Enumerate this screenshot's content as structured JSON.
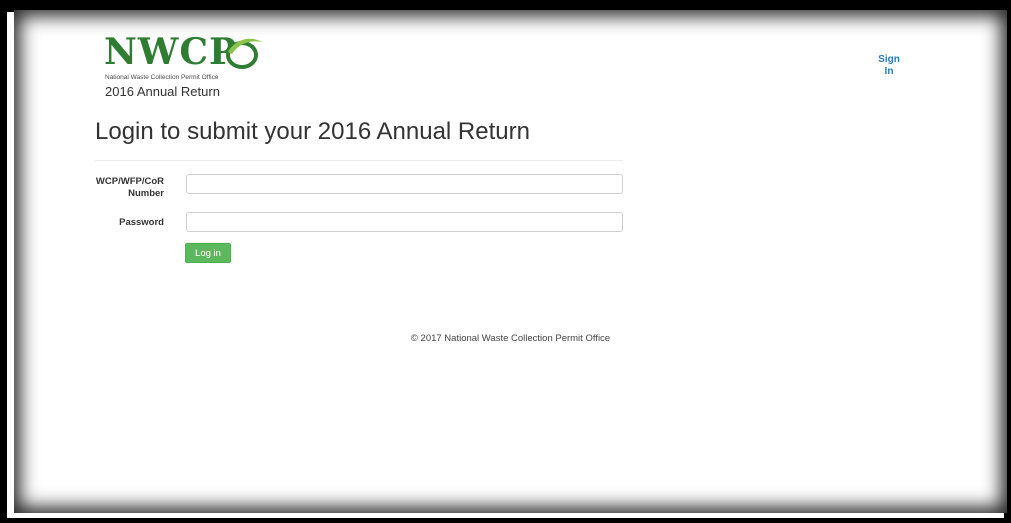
{
  "header": {
    "logo_text": "NWCPO",
    "logo_tagline": "National Waste Collection Permit Office",
    "subtitle": "2016 Annual Return",
    "sign_in_line1": "Sign",
    "sign_in_line2": "In"
  },
  "main": {
    "heading": "Login to submit your 2016 Annual Return",
    "form": {
      "wcp_label_line1": "WCP/WFP/CoR",
      "wcp_label_line2": "Number",
      "wcp_value": "",
      "password_label": "Password",
      "password_value": "",
      "login_button": "Log in"
    }
  },
  "footer": {
    "copyright": "© 2017 National Waste Collection Permit Office"
  },
  "colors": {
    "brand_green": "#2e7d32",
    "button_green": "#5cb85c",
    "link_blue": "#2a7ab7"
  }
}
